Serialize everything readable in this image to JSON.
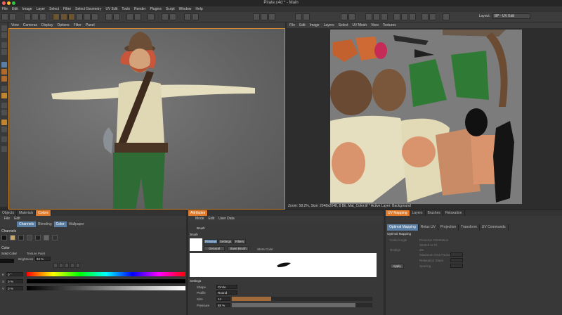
{
  "window": {
    "title": "Pirate.c4d * - Main"
  },
  "menu": [
    "File",
    "Edit",
    "Image",
    "Layer",
    "Select",
    "Filter",
    "Select Geometry",
    "UV Edit",
    "Tools",
    "Render",
    "Plugins",
    "Script",
    "Window",
    "Help"
  ],
  "toolbar": {
    "layout_label": "Layout:",
    "layout_value": "BP - UV Edit"
  },
  "viewport_menu": [
    "View",
    "Cameras",
    "Display",
    "Options",
    "Filter",
    "Panel"
  ],
  "uv_menu": [
    "File",
    "Edit",
    "Image",
    "Layers",
    "Select",
    "UV Mesh",
    "View",
    "Textures"
  ],
  "uv_status": "Zoom: 58.2%, Size: 2048x2048, 8 Bit, Mat_Color.tif * Active Layer: Background",
  "colors_panel": {
    "tabs": [
      "Objects",
      "Materials",
      "Colors"
    ],
    "menu": [
      "File",
      "Edit"
    ],
    "section_title": "Channels",
    "subtabs": [
      "Channels",
      "Blending",
      "Color",
      "Wallpaper"
    ],
    "color_title": "Color",
    "color_tabs": [
      "Solid Color",
      "Texture Paint"
    ],
    "brightness_label": "Brightness",
    "brightness_value": "34 %",
    "h_label": "H",
    "h_value": "0 °",
    "s_label": "S",
    "s_value": "0 %",
    "v_label": "V",
    "v_value": "0 %"
  },
  "attributes_panel": {
    "tab": "Attributes",
    "menu": [
      "Mode",
      "Edit",
      "User Data"
    ],
    "brush_row": "Brush",
    "brush_title": "Brush",
    "preview_tabs": [
      "Preview",
      "Settings",
      "Filters"
    ],
    "preset_value": "General",
    "save_brush": "Save Brush",
    "store_color": "Store Color",
    "settings_title": "Settings",
    "shape_label": "Shape",
    "shape_value": "Circle",
    "profile_label": "Profile",
    "profile_value": "Round",
    "size_label": "Size",
    "size_value": "14",
    "pressure_label": "Pressure",
    "pressure_value": "88 %",
    "size_fraction": 0.28,
    "pressure_fraction": 0.88
  },
  "uv_mapping_panel": {
    "tabs": [
      "UV Mapping",
      "Layers",
      "Brushes",
      "Relaxation"
    ],
    "subtabs": [
      "Optimal Mapping",
      "Relax UV",
      "Projection",
      "Transform",
      "UV Commands"
    ],
    "section_title": "Optimal Mapping",
    "options": [
      "Cubic/Angle",
      "Preserve Orientation",
      "Stretch to Fit",
      "Realign",
      "2D",
      "Maximum Area Factor",
      "Relaxation Steps",
      "Spacing"
    ],
    "apply_label": "Apply"
  },
  "accent_color": "#e07b2b"
}
